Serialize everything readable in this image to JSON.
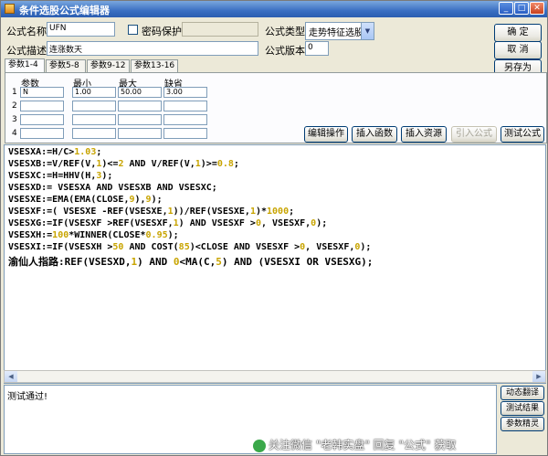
{
  "window": {
    "title": "条件选股公式编辑器"
  },
  "form": {
    "name_label": "公式名称",
    "name_value": "UFN",
    "password_label": "密码保护",
    "password_value": "",
    "desc_label": "公式描述",
    "desc_value": "连涨数天",
    "type_label": "公式类型",
    "type_value": "走势特征选股",
    "version_label": "公式版本",
    "version_value": "0"
  },
  "right_buttons": {
    "ok": "确 定",
    "cancel": "取 消",
    "save_as": "另存为"
  },
  "tabs": [
    "参数1-4",
    "参数5-8",
    "参数9-12",
    "参数13-16"
  ],
  "params": {
    "headers": [
      "参数",
      "最小",
      "最大",
      "缺省"
    ],
    "rows": [
      {
        "num": "1",
        "name": "N",
        "min": "1.00",
        "max": "50.00",
        "default": "3.00"
      },
      {
        "num": "2",
        "name": "",
        "min": "",
        "max": "",
        "default": ""
      },
      {
        "num": "3",
        "name": "",
        "min": "",
        "max": "",
        "default": ""
      },
      {
        "num": "4",
        "name": "",
        "min": "",
        "max": "",
        "default": ""
      }
    ]
  },
  "toolbar": {
    "edit": "编辑操作",
    "insert_func": "插入函数",
    "insert_res": "插入资源",
    "import": "引入公式",
    "test": "测试公式"
  },
  "code": [
    {
      "head": "VSESXA:=",
      "rest": "H/C>1.03;"
    },
    {
      "head": "VSESXB:=",
      "rest": "V/REF(V,1)<=2 AND V/REF(V,1)>=0.8;"
    },
    {
      "head": "VSESXC:=",
      "rest": "H=HHV(H,3);"
    },
    {
      "head": "VSESXD:=",
      "rest": " VSESXA AND VSESXB AND VSESXC;"
    },
    {
      "head": "VSESXE:=",
      "rest": "EMA(EMA(CLOSE,9),9);"
    },
    {
      "head": "VSESXF:=",
      "rest": "( VSESXE -REF(VSESXE,1))/REF(VSESXE,1)*1000;"
    },
    {
      "head": "VSESXG:=",
      "rest": "IF(VSESXF >REF(VSESXF,1) AND VSESXF >0, VSESXF,0);"
    },
    {
      "head": "VSESXH:=",
      "rest": "100*WINNER(CLOSE*0.95);"
    },
    {
      "head": "VSESXI:=",
      "rest": "IF(VSESXH >50 AND COST(85)<CLOSE AND VSESXF >0, VSESXF,0);"
    },
    {
      "head": "渝仙人指路:",
      "rest": "REF(VSESXD,1) AND 0<MA(C,5) AND (VSESXI OR VSESXG);"
    }
  ],
  "output_text": "测试通过!",
  "side_buttons": {
    "translate": "动态翻译",
    "test_result": "测试结果",
    "param_wizard": "参数精灵"
  },
  "watermark": "关注微信 \"老韩实盘\" 回复 \"公式\" 获取",
  "colors": {
    "head": "#1a1a1a",
    "number": "#c8a400",
    "titlebar": "#3a6fc2"
  },
  "icons": [
    "app-icon",
    "minimize-icon",
    "maximize-icon",
    "close-icon",
    "dropdown-arrow-icon",
    "scroll-left-icon",
    "scroll-right-icon",
    "wechat-logo-icon"
  ]
}
